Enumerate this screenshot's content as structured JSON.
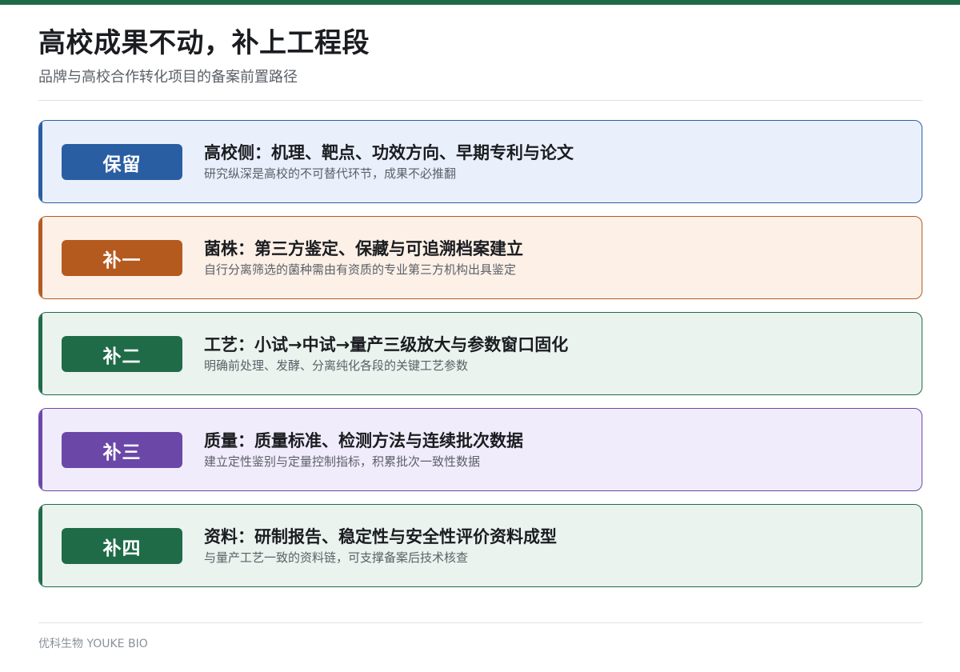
{
  "header": {
    "title": "高校成果不动，补上工程段",
    "subtitle": "品牌与高校合作转化项目的备案前置路径"
  },
  "steps": [
    {
      "badge": "保留",
      "heading": "高校侧：机理、靶点、功效方向、早期专利与论文",
      "desc": "研究纵深是高校的不可替代环节，成果不必推翻",
      "colors": {
        "accent": "#2a5ea3",
        "bg": "#e9f0fb",
        "border": "#2a5ea3"
      }
    },
    {
      "badge": "补一",
      "heading": "菌株：第三方鉴定、保藏与可追溯档案建立",
      "desc": "自行分离筛选的菌种需由有资质的专业第三方机构出具鉴定",
      "colors": {
        "accent": "#b55a1f",
        "bg": "#fdf0e7",
        "border": "#b55a1f"
      }
    },
    {
      "badge": "补二",
      "heading": "工艺：小试→中试→量产三级放大与参数窗口固化",
      "desc": "明确前处理、发酵、分离纯化各段的关键工艺参数",
      "colors": {
        "accent": "#1f6b48",
        "bg": "#eaf3ee",
        "border": "#1f6b48"
      }
    },
    {
      "badge": "补三",
      "heading": "质量：质量标准、检测方法与连续批次数据",
      "desc": "建立定性鉴别与定量控制指标，积累批次一致性数据",
      "colors": {
        "accent": "#6b47a8",
        "bg": "#f1ecfb",
        "border": "#6b47a8"
      }
    },
    {
      "badge": "补四",
      "heading": "资料：研制报告、稳定性与安全性评价资料成型",
      "desc": "与量产工艺一致的资料链，可支撑备案后技术核查",
      "colors": {
        "accent": "#1f6b48",
        "bg": "#eaf3ee",
        "border": "#1f6b48"
      }
    }
  ],
  "footer": {
    "brand": "优科生物 YOUKE BIO"
  }
}
